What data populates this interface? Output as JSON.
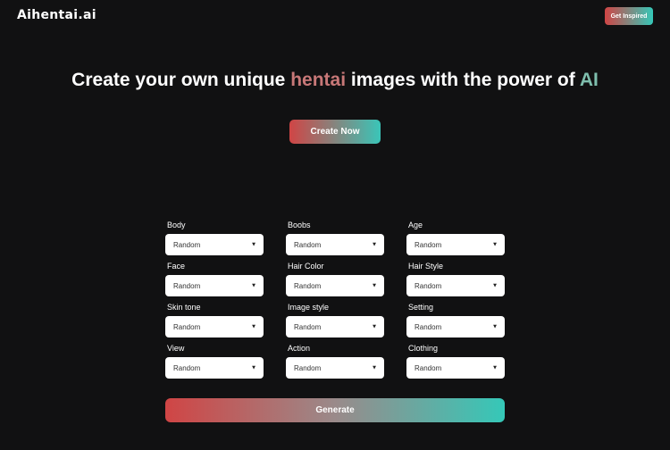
{
  "header": {
    "logo": "Aihentai.ai",
    "inspire_label": "Get Inspired"
  },
  "hero": {
    "title_part1": "Create your own unique ",
    "title_accent1": "hentai",
    "title_part2": " images with the power of ",
    "title_accent2": "AI",
    "cta_label": "Create Now"
  },
  "form": {
    "fields": [
      {
        "label": "Body",
        "value": "Random"
      },
      {
        "label": "Boobs",
        "value": "Random"
      },
      {
        "label": "Age",
        "value": "Random"
      },
      {
        "label": "Face",
        "value": "Random"
      },
      {
        "label": "Hair Color",
        "value": "Random"
      },
      {
        "label": "Hair Style",
        "value": "Random"
      },
      {
        "label": "Skin tone",
        "value": "Random"
      },
      {
        "label": "Image style",
        "value": "Random"
      },
      {
        "label": "Setting",
        "value": "Random"
      },
      {
        "label": "View",
        "value": "Random"
      },
      {
        "label": "Action",
        "value": "Random"
      },
      {
        "label": "Clothing",
        "value": "Random"
      }
    ],
    "generate_label": "Generate"
  },
  "icons": {
    "dropdown": "caret-down-icon"
  },
  "colors": {
    "background": "#111112",
    "gradient_start": "#d04545",
    "gradient_end": "#35c8b8",
    "accent_red_text": "#c87878",
    "accent_teal_text": "#7fbfae"
  }
}
